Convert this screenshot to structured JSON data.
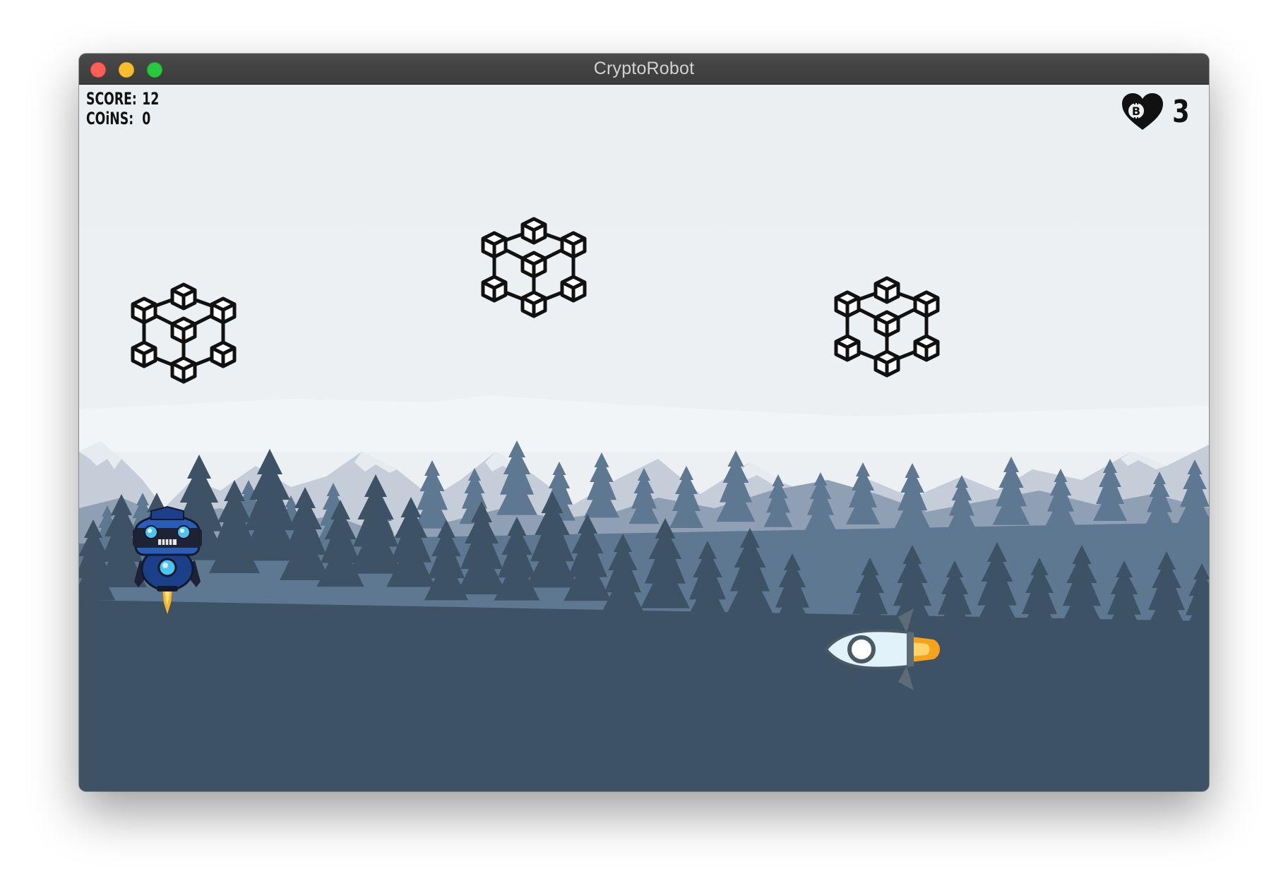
{
  "window": {
    "title": "CryptoRobot"
  },
  "hud": {
    "score_label": "SCORE:",
    "score_value": "12",
    "coins_label": "COiNS:",
    "coins_value": "0",
    "lives_value": "3",
    "lives_icon": "bitcoin-heart-icon"
  },
  "entities": {
    "player": "robot",
    "enemy": "rocket",
    "obstacles": [
      "blockchain-cube",
      "blockchain-cube",
      "blockchain-cube"
    ]
  },
  "colors": {
    "sky": "#ecf0f3",
    "mountains_far": "#c3ccd7",
    "mountains_mid": "#8e9fb3",
    "trees_mid": "#5f7891",
    "trees_front": "#3d5164"
  }
}
